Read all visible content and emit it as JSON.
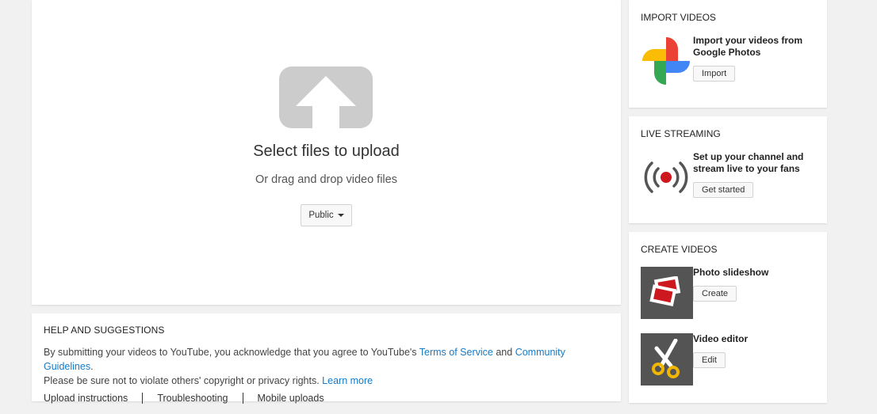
{
  "upload": {
    "title": "Select files to upload",
    "subtitle": "Or drag and drop video files",
    "privacy": "Public"
  },
  "help": {
    "heading": "HELP AND SUGGESTIONS",
    "text_1": "By submitting your videos to YouTube, you acknowledge that you agree to YouTube's ",
    "tos_link": "Terms of Service",
    "text_and": " and ",
    "guidelines_link": "Community Guidelines",
    "text_2": ".",
    "text_3": "Please be sure not to violate others' copyright or privacy rights. ",
    "learn_more": "Learn more",
    "links": [
      "Upload instructions",
      "Troubleshooting",
      "Mobile uploads"
    ]
  },
  "import": {
    "heading": "IMPORT VIDEOS",
    "text": "Import your videos from Google Photos",
    "button": "Import"
  },
  "live": {
    "heading": "LIVE STREAMING",
    "text": "Set up your channel and stream live to your fans",
    "button": "Get started"
  },
  "create": {
    "heading": "CREATE VIDEOS",
    "items": [
      {
        "title": "Photo slideshow",
        "button": "Create",
        "icon": "slideshow-icon"
      },
      {
        "title": "Video editor",
        "button": "Edit",
        "icon": "scissors-icon"
      }
    ]
  },
  "colors": {
    "link": "#167ac6",
    "live_red": "#cc181e",
    "icon_gray": "#cccccc",
    "thumb_bg": "#545454",
    "scissors": "#f1b700"
  }
}
